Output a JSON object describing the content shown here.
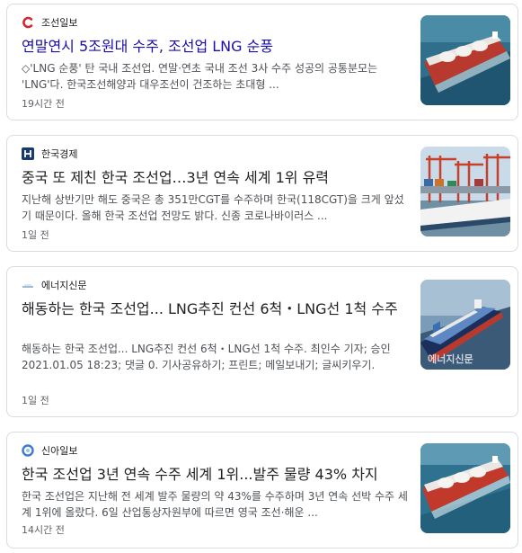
{
  "articles": [
    {
      "source": "조선일보",
      "source_icon": "chosun-logo-icon",
      "title": "연말연시 5조원대 수주, 조선업 LNG 순풍",
      "snippet": "◇'LNG 순풍' 탄 국내 조선업. 연말·연초 국내 조선 3사 수주 성공의 공통분모는 'LNG'다. 한국조선해양과 대우조선이 건조하는 초대형 ...",
      "time": "19시간 전",
      "thumb": "lng-carrier-image"
    },
    {
      "source": "한국경제",
      "source_icon": "hankyung-logo-icon",
      "title": "중국 또 제친 한국 조선업…3년 연속 세계 1위 유력",
      "snippet": "지난해 상반기만 해도 중국은 총 351만CGT를 수주하며 한국(118CGT)을 크게 앞섰기 때문이다. 올해 한국 조선업 전망도 밝다. 신종 코로나바이러스 ...",
      "time": "1일 전",
      "thumb": "port-cranes-image"
    },
    {
      "source": "에너지신문",
      "source_icon": "energy-news-logo-icon",
      "title": "해동하는 한국 조선업... LNG추진 컨선 6척・LNG선 1척 수주",
      "snippet": "해동하는 한국 조선업... LNG추진 컨선 6척・LNG선 1척 수주. 최인수 기자; 승인 2021.01.05 18:23; 댓글 0. 기사공유하기; 프린트; 메일보내기; 글씨키우기.",
      "time": "1일 전",
      "thumb": "container-ship-image",
      "watermark": "에너지신문"
    },
    {
      "source": "신아일보",
      "source_icon": "shinailbo-logo-icon",
      "title": "한국 조선업 3년 연속 수주 세계 1위...발주 물량 43% 차지",
      "snippet": "한국 조선업은 지난해 전 세계 발주 물량의 약 43%를 수주하며 3년 연속 선박 수주 세계 1위에 올랐다. 6일 산업통상자원부에 따르면 영국 조선·해운 ...",
      "time": "14시간 전",
      "thumb": "lng-carrier-image-2"
    }
  ]
}
